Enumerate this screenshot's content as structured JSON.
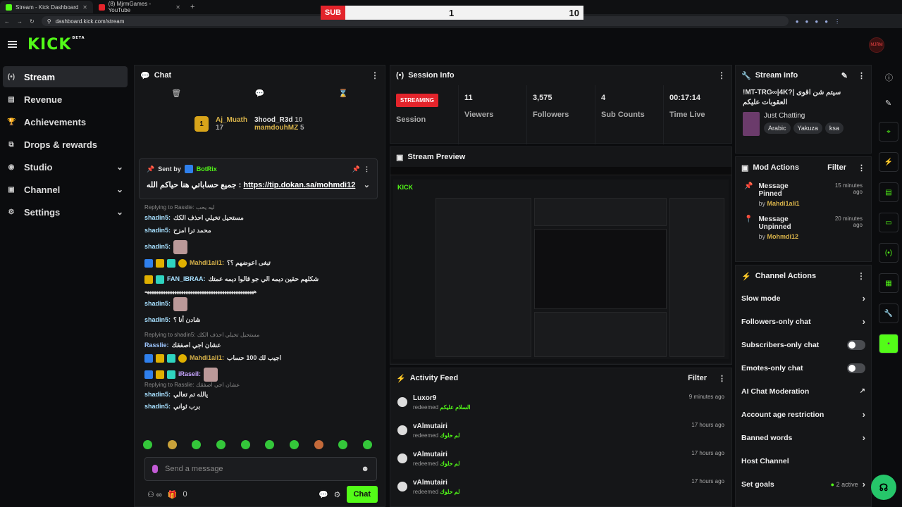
{
  "browser": {
    "tabs": [
      {
        "label": "Stream - Kick Dashboard",
        "color": "#53fc18"
      },
      {
        "label": "(8) MjrmGames - YouTube",
        "color": "#e3242b"
      }
    ],
    "url": "dashboard.kick.com/stream"
  },
  "scoreboard": {
    "label": "SUB",
    "left": "1",
    "right": "10"
  },
  "app": {
    "logo": "KICK",
    "beta": "BETA",
    "avatar": "MJRM"
  },
  "sidebar": {
    "items": [
      {
        "label": "Stream",
        "icon": "(•)"
      },
      {
        "label": "Revenue",
        "icon": "▤"
      },
      {
        "label": "Achievements",
        "icon": "🏆"
      },
      {
        "label": "Drops & rewards",
        "icon": "⧉"
      },
      {
        "label": "Studio",
        "icon": "◉"
      },
      {
        "label": "Channel",
        "icon": "▣"
      },
      {
        "label": "Settings",
        "icon": "⚙"
      }
    ]
  },
  "chat": {
    "title": "Chat",
    "leaderboard": {
      "first": "Aj_Muath",
      "first_count": "17",
      "second": "3hood_R3d",
      "second_count": "10",
      "third": "mamdouhMZ",
      "third_count": "5"
    },
    "pinned": {
      "sent_by": "Sent by",
      "bot": "BotRix",
      "message": "جميع حساباتي هنا حياكم الله :",
      "link": "https://tip.dokan.sa/mohmdi12"
    },
    "messages": [
      {
        "reply": "Replying to Rasslie: ليه يحب"
      },
      {
        "user": "shadin5:",
        "text": "مستحيل تخيلي احذف الكك"
      },
      {
        "user": "shadin5:",
        "text": "محمد ترا امزح"
      },
      {
        "user": "shadin5:",
        "text": ""
      },
      {
        "user": "Mahdi1ali1:",
        "text": "تبغى اعوضهم ؟؟"
      },
      {
        "user": "FAN_IBRAA:",
        "text": "شكلهم حقين ديمه الي جو قالوا ديمه عمتك"
      },
      {
        "text": "ههههههههههههههههههههههههههههههههههههههههههههههههه"
      },
      {
        "user": "shadin5:",
        "text": ""
      },
      {
        "user": "shadin5:",
        "text": "شادن أنا ؟"
      },
      {
        "reply": "Replying to shadin5: مستحيل تخيلي احذف الكك"
      },
      {
        "user": "Rasslie:",
        "text": "عشان اجي اصفقك"
      },
      {
        "user": "Mahdi1ali1:",
        "text": "اجيب لك 100 حساب"
      },
      {
        "user": "iRaseil:",
        "text": ""
      },
      {
        "reply": "Replying to Rasslie: عشان اجي اصفقك"
      },
      {
        "user": "shadin5:",
        "text": "يالله تم تعالي"
      },
      {
        "user": "shadin5:",
        "text": "برب ثواني"
      }
    ],
    "placeholder": "Send a message",
    "count": "0",
    "chat_btn": "Chat"
  },
  "session": {
    "title": "Session Info",
    "status": "STREAMING",
    "status_label": "Session",
    "viewers": "11",
    "viewers_label": "Viewers",
    "followers": "3,575",
    "followers_label": "Followers",
    "subs": "4",
    "subs_label": "Sub Counts",
    "time": "00:17:14",
    "time_label": "Time Live"
  },
  "preview": {
    "title": "Stream Preview"
  },
  "feed": {
    "title": "Activity Feed",
    "filter": "Filter",
    "items": [
      {
        "name": "Luxor9",
        "action": "redeemed",
        "reward": "السلام عليكم",
        "time": "9 minutes ago"
      },
      {
        "name": "vAlmutairi",
        "action": "redeemed",
        "reward": "لم حلوك",
        "time": "17 hours ago"
      },
      {
        "name": "vAlmutairi",
        "action": "redeemed",
        "reward": "لم حلوك",
        "time": "17 hours ago"
      },
      {
        "name": "vAlmutairi",
        "action": "redeemed",
        "reward": "لم حلوك",
        "time": "17 hours ago"
      }
    ]
  },
  "stream_info": {
    "title": "Stream info",
    "stream_title": "!MT-TRG∞|4K?| سيتم شن اقوى العقوبات عليكم",
    "category": "Just Chatting",
    "tags": [
      "Arabic",
      "Yakuza",
      "ksa"
    ]
  },
  "mod": {
    "title": "Mod Actions",
    "filter": "Filter",
    "items": [
      {
        "action": "Message Pinned",
        "by": "by",
        "user": "Mahdi1ali1",
        "time": "15 minutes ago"
      },
      {
        "action": "Message Unpinned",
        "by": "by",
        "user": "Mohmdi12",
        "time": "20 minutes ago"
      }
    ]
  },
  "channel_actions": {
    "title": "Channel Actions",
    "rows": [
      {
        "label": "Slow mode"
      },
      {
        "label": "Followers-only chat"
      },
      {
        "label": "Subscribers-only chat"
      },
      {
        "label": "Emotes-only chat"
      },
      {
        "label": "AI Chat Moderation"
      },
      {
        "label": "Account age restriction"
      },
      {
        "label": "Banned words"
      },
      {
        "label": "Host Channel"
      },
      {
        "label": "Set goals",
        "status": "2 active"
      }
    ]
  }
}
